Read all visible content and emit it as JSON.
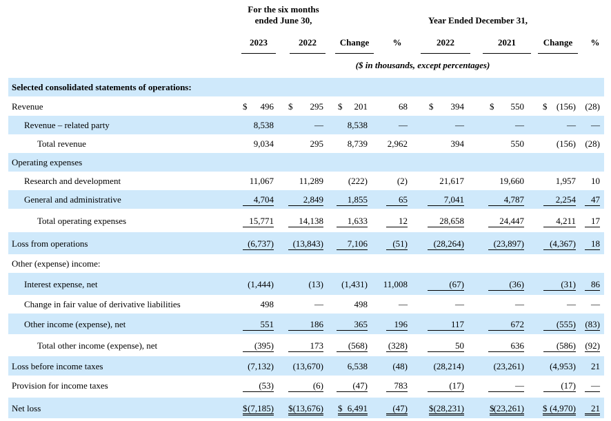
{
  "header": {
    "six_months": "For the six months ended June 30,",
    "year_ended": "Year Ended December 31,",
    "note": "($ in thousands, except percentages)"
  },
  "columns": [
    "2023",
    "2022",
    "Change",
    "%",
    "2022",
    "2021",
    "Change",
    "%"
  ],
  "rows": [
    {
      "label": "Selected consolidated statements of operations:",
      "bold": true,
      "indent": 0,
      "cells": [
        "",
        "",
        "",
        "",
        "",
        "",
        "",
        ""
      ]
    },
    {
      "label": "Revenue",
      "indent": 0,
      "dollar": [
        true,
        true,
        true,
        false,
        true,
        true,
        true,
        false
      ],
      "cells": [
        "496",
        "295",
        "201",
        "68",
        "394",
        "550",
        "(156)",
        "(28)"
      ]
    },
    {
      "label": "Revenue – related party",
      "indent": 1,
      "cells": [
        "8,538",
        "—",
        "8,538",
        "—",
        "—",
        "—",
        "—",
        "—"
      ]
    },
    {
      "label": "Total revenue",
      "indent": 2,
      "cells": [
        "9,034",
        "295",
        "8,739",
        "2,962",
        "394",
        "550",
        "(156)",
        "(28)"
      ]
    },
    {
      "label": "Operating expenses",
      "indent": 0,
      "cells": [
        "",
        "",
        "",
        "",
        "",
        "",
        "",
        ""
      ]
    },
    {
      "label": "Research and development",
      "indent": 1,
      "cells": [
        "11,067",
        "11,289",
        "(222)",
        "(2)",
        "21,617",
        "19,660",
        "1,957",
        "10"
      ]
    },
    {
      "label": "General and administrative",
      "indent": 1,
      "ul": "single",
      "cells": [
        "4,704",
        "2,849",
        "1,855",
        "65",
        "7,041",
        "4,787",
        "2,254",
        "47"
      ]
    },
    {
      "label": "Total operating expenses",
      "indent": 2,
      "ul": "single",
      "cells": [
        "15,771",
        "14,138",
        "1,633",
        "12",
        "28,658",
        "24,447",
        "4,211",
        "17"
      ]
    },
    {
      "label": "Loss from operations",
      "indent": 0,
      "ul": "single",
      "cells": [
        "(6,737)",
        "(13,843)",
        "7,106",
        "(51)",
        "(28,264)",
        "(23,897)",
        "(4,367)",
        "18"
      ]
    },
    {
      "label": "Other (expense) income:",
      "indent": 0,
      "cells": [
        "",
        "",
        "",
        "",
        "",
        "",
        "",
        ""
      ]
    },
    {
      "label": "Interest expense, net",
      "indent": 1,
      "ul_cols": [
        4,
        5,
        6,
        7
      ],
      "cells": [
        "(1,444)",
        "(13)",
        "(1,431)",
        "11,008",
        "(67)",
        "(36)",
        "(31)",
        "86"
      ]
    },
    {
      "label": "Change in fair value of derivative liabilities",
      "indent": 1,
      "cells": [
        "498",
        "—",
        "498",
        "—",
        "—",
        "—",
        "—",
        "—"
      ]
    },
    {
      "label": "Other income (expense), net",
      "indent": 1,
      "ul": "single",
      "cells": [
        "551",
        "186",
        "365",
        "196",
        "117",
        "672",
        "(555)",
        "(83)"
      ]
    },
    {
      "label": "Total other income (expense), net",
      "indent": 2,
      "ul": "single",
      "cells": [
        "(395)",
        "173",
        "(568)",
        "(328)",
        "50",
        "636",
        "(586)",
        "(92)"
      ]
    },
    {
      "label": "Loss before income taxes",
      "indent": 0,
      "cells": [
        "(7,132)",
        "(13,670)",
        "6,538",
        "(48)",
        "(28,214)",
        "(23,261)",
        "(4,953)",
        "21"
      ]
    },
    {
      "label": "Provision for income taxes",
      "indent": 0,
      "ul": "single",
      "cells": [
        "(53)",
        "(6)",
        "(47)",
        "783",
        "(17)",
        "—",
        "(17)",
        "—"
      ]
    },
    {
      "label": "Net loss",
      "indent": 0,
      "ul": "double",
      "dollar": [
        true,
        true,
        true,
        false,
        true,
        true,
        true,
        false
      ],
      "cells": [
        "(7,185)",
        "(13,676)",
        "6,491",
        "(47)",
        "(28,231)",
        "(23,261)",
        "(4,970)",
        "21"
      ]
    }
  ],
  "colors": {
    "shade": "#cfe9fb"
  }
}
